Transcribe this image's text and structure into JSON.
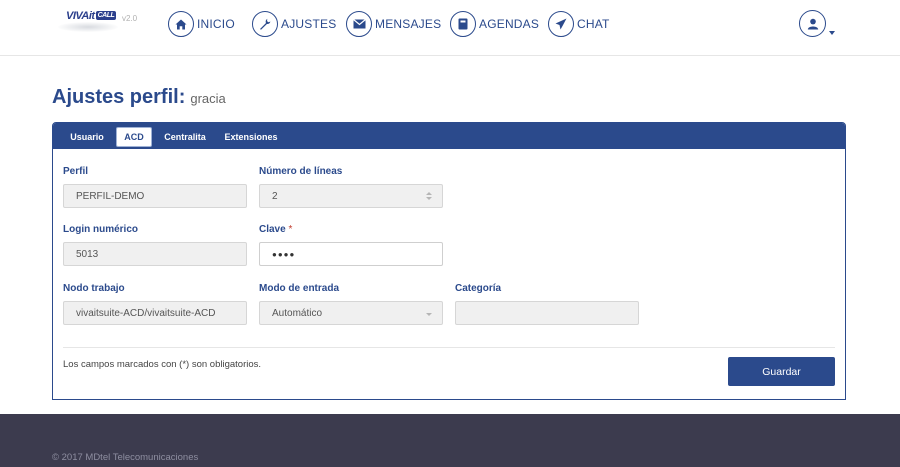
{
  "brand": {
    "logo_text": "VIVAit",
    "logo_badge": "CALL",
    "version": "v2.0"
  },
  "nav": {
    "items": [
      {
        "label": "INICIO",
        "icon": "home-icon"
      },
      {
        "label": "AJUSTES",
        "icon": "wrench-icon"
      },
      {
        "label": "MENSAJES",
        "icon": "envelope-icon"
      },
      {
        "label": "AGENDAS",
        "icon": "book-icon"
      },
      {
        "label": "CHAT",
        "icon": "send-icon"
      }
    ]
  },
  "page": {
    "title": "Ajustes perfil:",
    "subtitle": "gracia"
  },
  "tabs": [
    {
      "label": "Usuario",
      "active": false
    },
    {
      "label": "ACD",
      "active": true
    },
    {
      "label": "Centralita",
      "active": false
    },
    {
      "label": "Extensiones",
      "active": false
    }
  ],
  "form": {
    "perfil": {
      "label": "Perfil",
      "value": "PERFIL-DEMO"
    },
    "num_lineas": {
      "label": "Número de líneas",
      "value": "2"
    },
    "login": {
      "label": "Login numérico",
      "value": "5013"
    },
    "clave": {
      "label": "Clave",
      "required_mark": "*",
      "value": "●●●●"
    },
    "nodo": {
      "label": "Nodo trabajo",
      "value": "vivaitsuite-ACD/vivaitsuite-ACD"
    },
    "modo": {
      "label": "Modo de entrada",
      "value": "Automático"
    },
    "categoria": {
      "label": "Categoría",
      "value": ""
    },
    "note": "Los campos marcados con (*) son obligatorios.",
    "save_label": "Guardar"
  },
  "footer": {
    "copyright": "© 2017 MDtel Telecomunicaciones"
  },
  "colors": {
    "primary": "#2b4a8c",
    "footer_bg": "#3c3b4e",
    "required": "#c0392b"
  }
}
